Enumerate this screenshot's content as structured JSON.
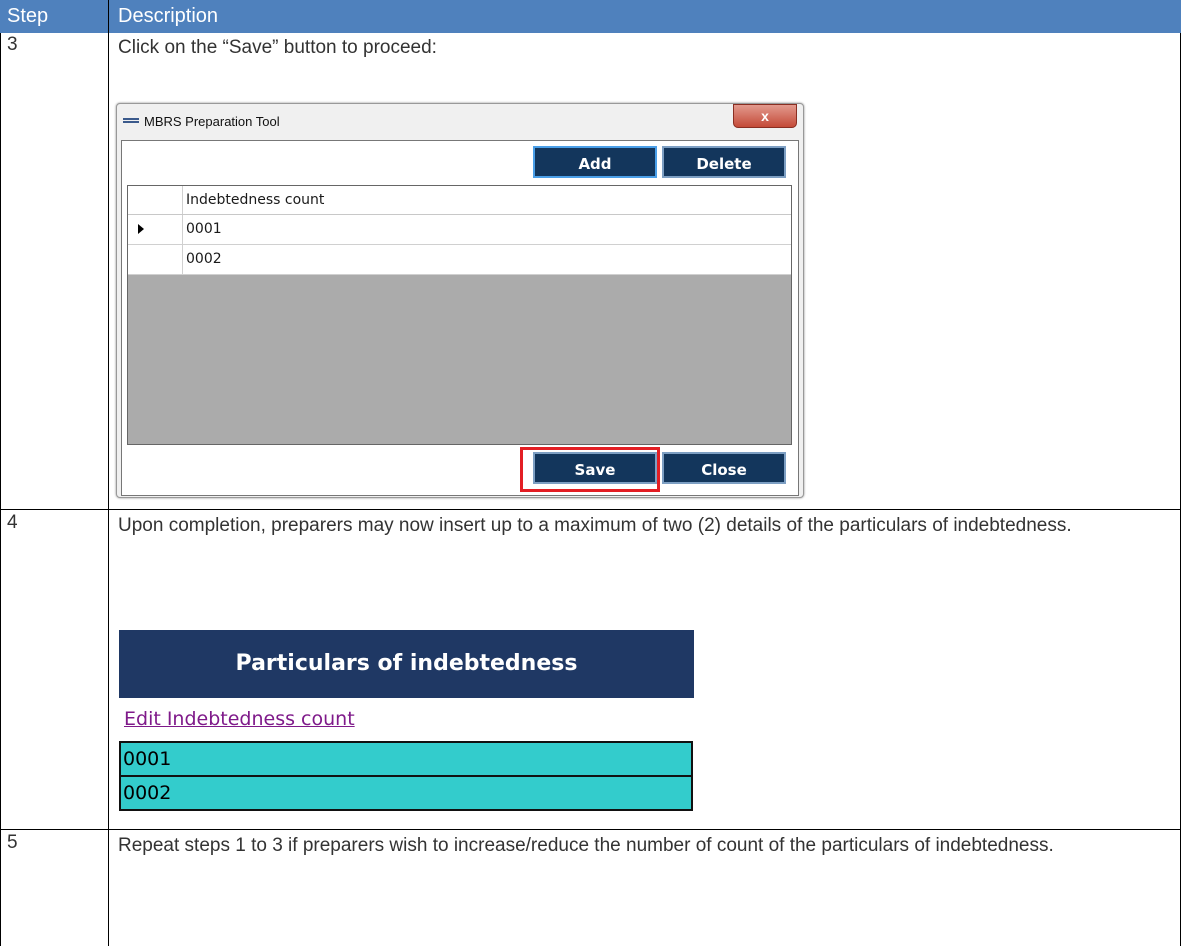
{
  "table": {
    "header": {
      "step": "Step",
      "description": "Description"
    },
    "rows": [
      {
        "step": "3",
        "text": "Click on the “Save” button to proceed:"
      },
      {
        "step": "4",
        "text": "Upon completion, preparers may now insert up to a maximum of two (2) details of the particulars of indebtedness."
      },
      {
        "step": "5",
        "text": "Repeat steps 1 to 3 if preparers wish to increase/reduce the number of count of the particulars of indebtedness."
      }
    ]
  },
  "dialog": {
    "title": "MBRS Preparation Tool",
    "close_glyph": "x",
    "add_label": "Add",
    "delete_label": "Delete",
    "column_header": "Indebtedness count",
    "rows": [
      "0001",
      "0002"
    ],
    "save_label": "Save",
    "close_label": "Close"
  },
  "excel": {
    "section_title": "Particulars of indebtedness",
    "edit_link": "Edit Indebtedness count",
    "cells": [
      "0001",
      "0002"
    ]
  },
  "colors": {
    "header_bg": "#4f81bd",
    "dialog_button": "#13365c",
    "highlight": "#e31e24",
    "excel_header": "#1f3864",
    "teal": "#33cccc",
    "link": "#7f1a8a"
  }
}
